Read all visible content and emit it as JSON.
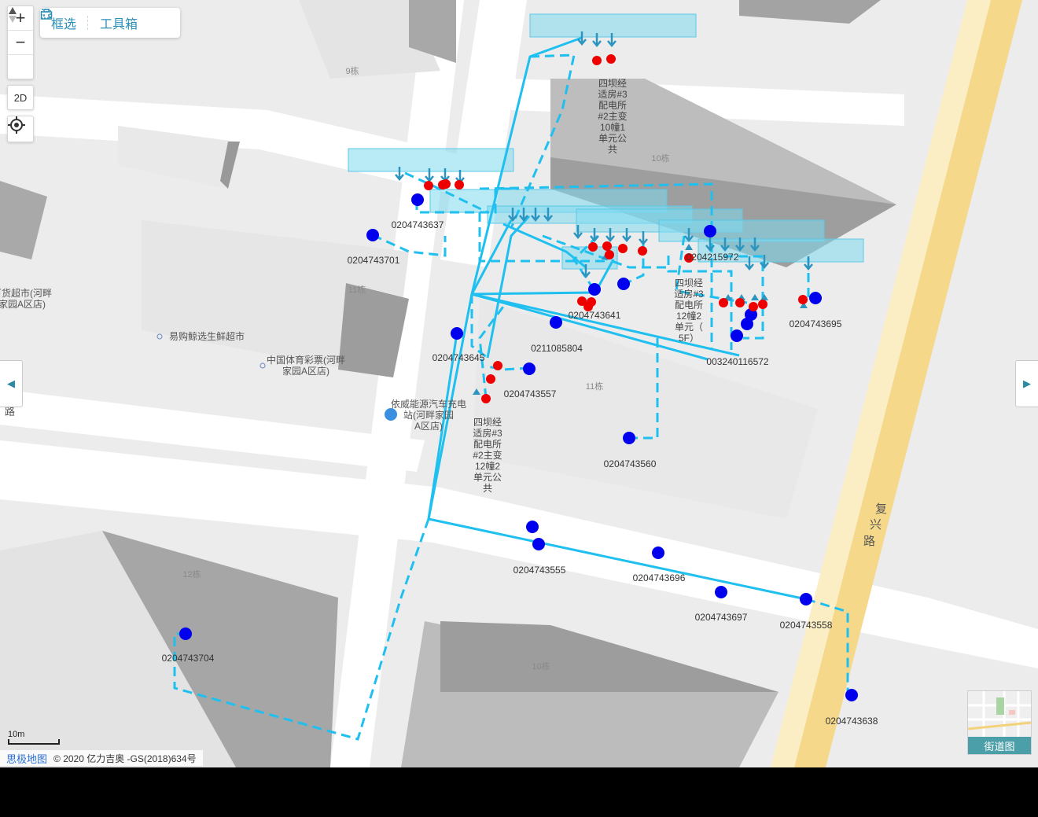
{
  "controls": {
    "zoom_in": "+",
    "zoom_out": "−",
    "compass": "▲",
    "mode_2d": "2D"
  },
  "toolbar": {
    "select_label": "框选",
    "toolbox_label": "工具箱"
  },
  "street_view": {
    "label": "街道图"
  },
  "scale": {
    "label": "10m"
  },
  "credits": {
    "brand": "思极地图",
    "copyright": "© 2020 亿力吉奥 -GS(2018)634号"
  },
  "colors": {
    "line": "#1fc0ef",
    "device_blue": "#0000ee",
    "device_red": "#ee0000",
    "highlight_box": "#7fdbf0"
  },
  "map_labels": {
    "buildings": [
      "9栋",
      "10栋",
      "11栋",
      "11栋",
      "12栋",
      "10栋"
    ],
    "roads": [
      "复",
      "兴",
      "路",
      "路"
    ],
    "pois": [
      "易购鲸选生鲜超市",
      "中国体育彩票(河畔家园A区店)",
      "依威能源汽车充电站(河畔家园A区店)",
      "百货超市(河畔家园A区店)"
    ],
    "stations": [
      "四坝经适房#3配电所#2主变10幢1单元公共",
      "四坝经适房#3配电所12幢2单元（5F）",
      "四坝经适房#3配电所#2主变12幢2单元公共"
    ],
    "device_ids": [
      "0204743637",
      "0204743701",
      "0204215972",
      "0204743641",
      "0204743695",
      "0204743645",
      "0211085804",
      "0204743557",
      "003240116572",
      "0204743560",
      "0204743555",
      "0204743696",
      "0204743697",
      "0204743558",
      "0204743704",
      "0204743638"
    ]
  }
}
